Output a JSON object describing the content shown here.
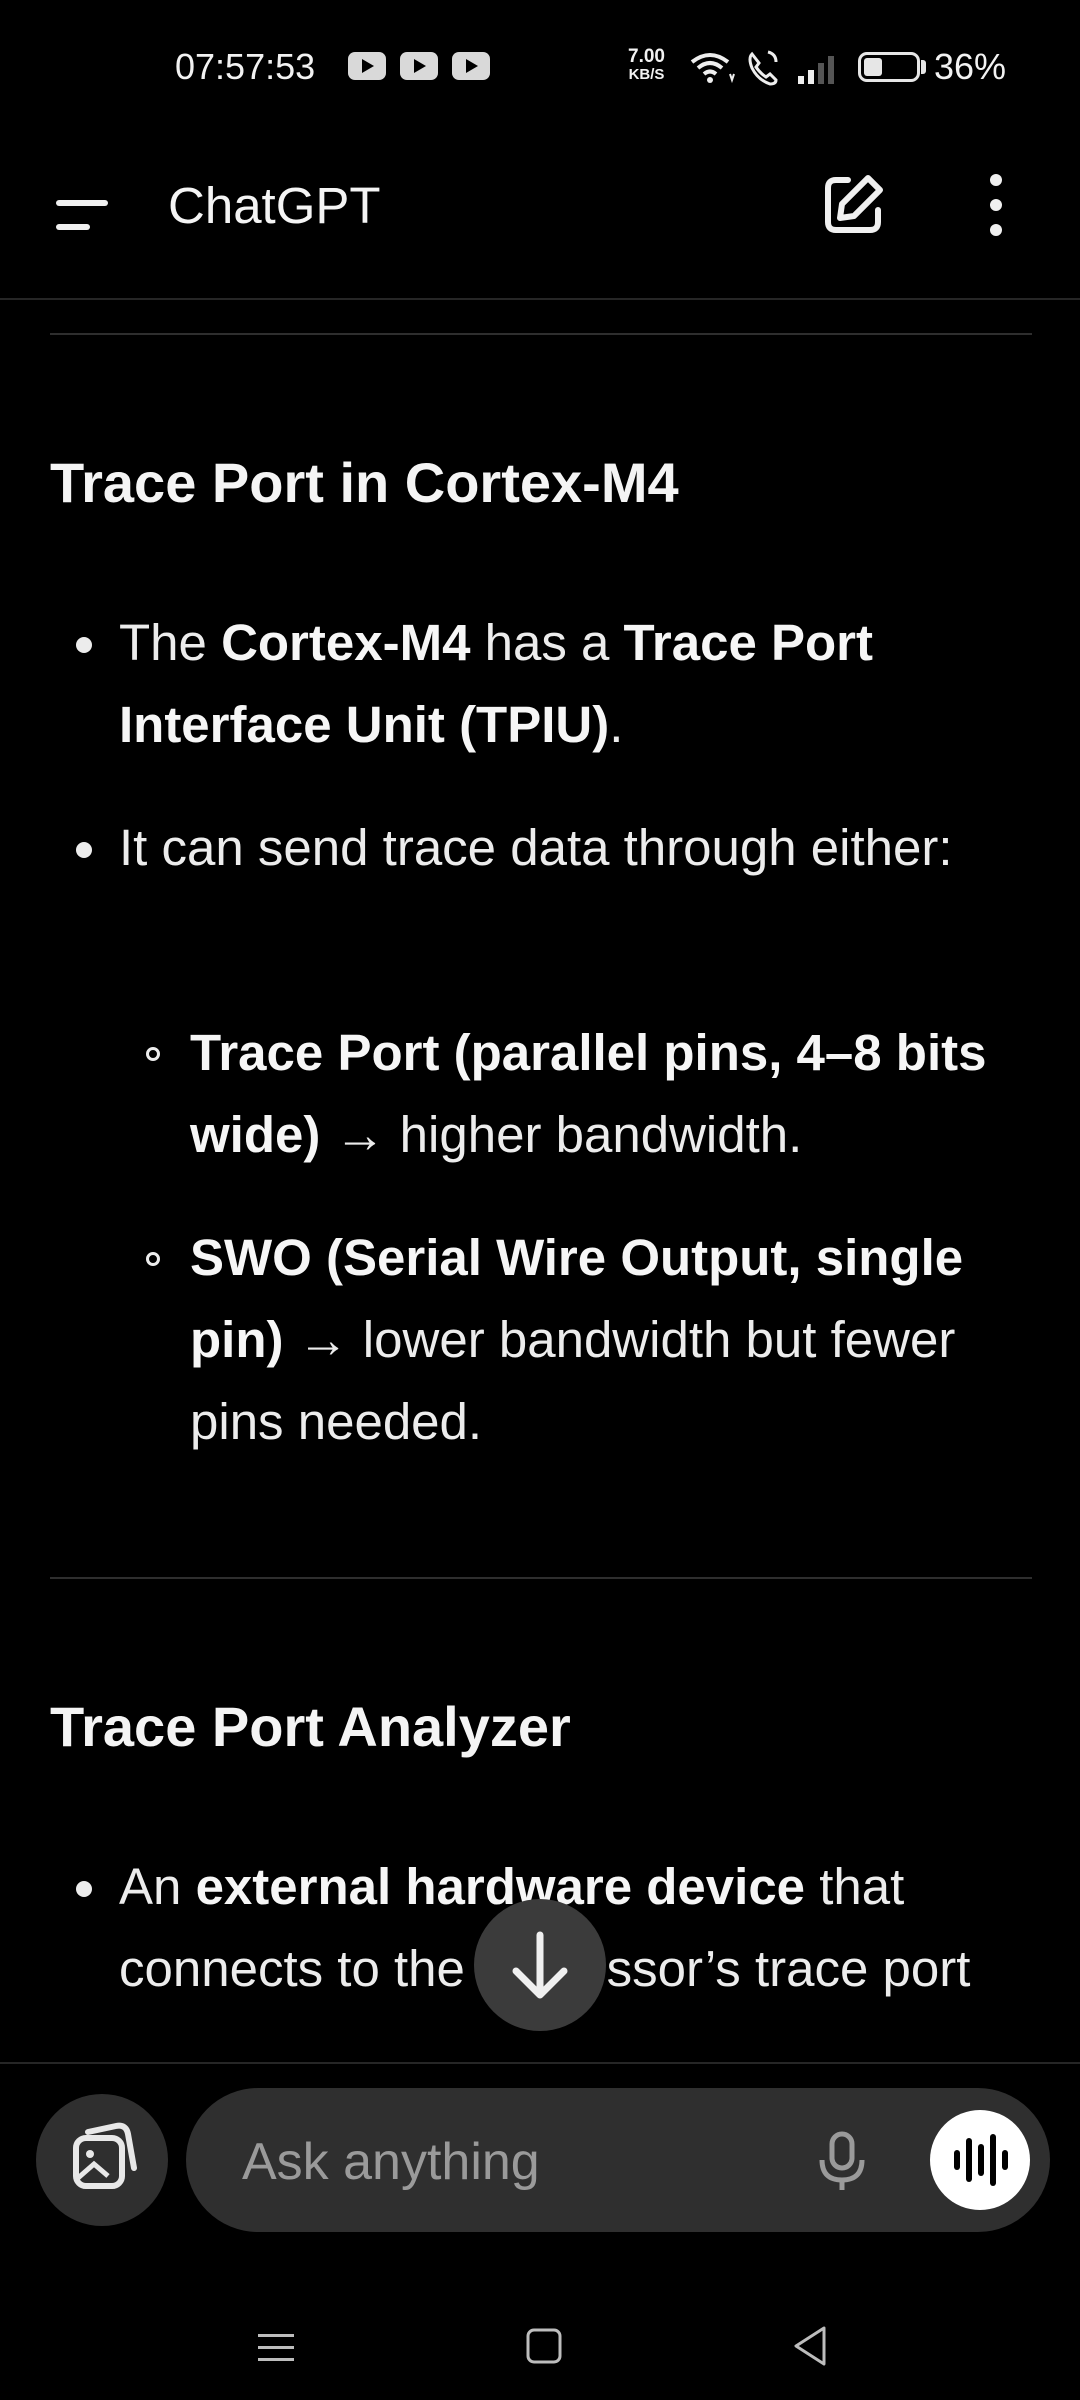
{
  "status_bar": {
    "time": "07:57:53",
    "net_speed_value": "7.00",
    "net_speed_unit": "KB/S",
    "battery_percent": "36%",
    "battery_level": 0.36
  },
  "app_bar": {
    "title": "ChatGPT"
  },
  "content": {
    "section1": {
      "heading": "Trace Port in Cortex-M4",
      "bullet1": {
        "t1": "The ",
        "b1": "Cortex-M4",
        "t2": " has a ",
        "b2": "Trace Port Interface Unit (TPIU)",
        "t3": "."
      },
      "bullet2": "It can send trace data through either:",
      "sub1": {
        "bold": "Trace Port (parallel pins, 4–8 bits wide)",
        "rest": " → higher bandwidth."
      },
      "sub2": {
        "bold": "SWO (Serial Wire Output, single pin)",
        "rest": " → lower bandwidth but fewer pins needed."
      }
    },
    "section2": {
      "heading": "Trace Port Analyzer",
      "bullet1": {
        "t1": "An ",
        "b1": "external hardware device",
        "t2": " that connects to the processor’s trace port"
      }
    }
  },
  "composer": {
    "placeholder": "Ask anything"
  },
  "icons": {
    "menu": "menu-icon",
    "new_chat": "edit-icon",
    "more": "more-vertical-icon",
    "scroll_down": "arrow-down-icon",
    "media": "image-gallery-icon",
    "mic": "microphone-icon",
    "voice": "voice-waveform-icon"
  }
}
